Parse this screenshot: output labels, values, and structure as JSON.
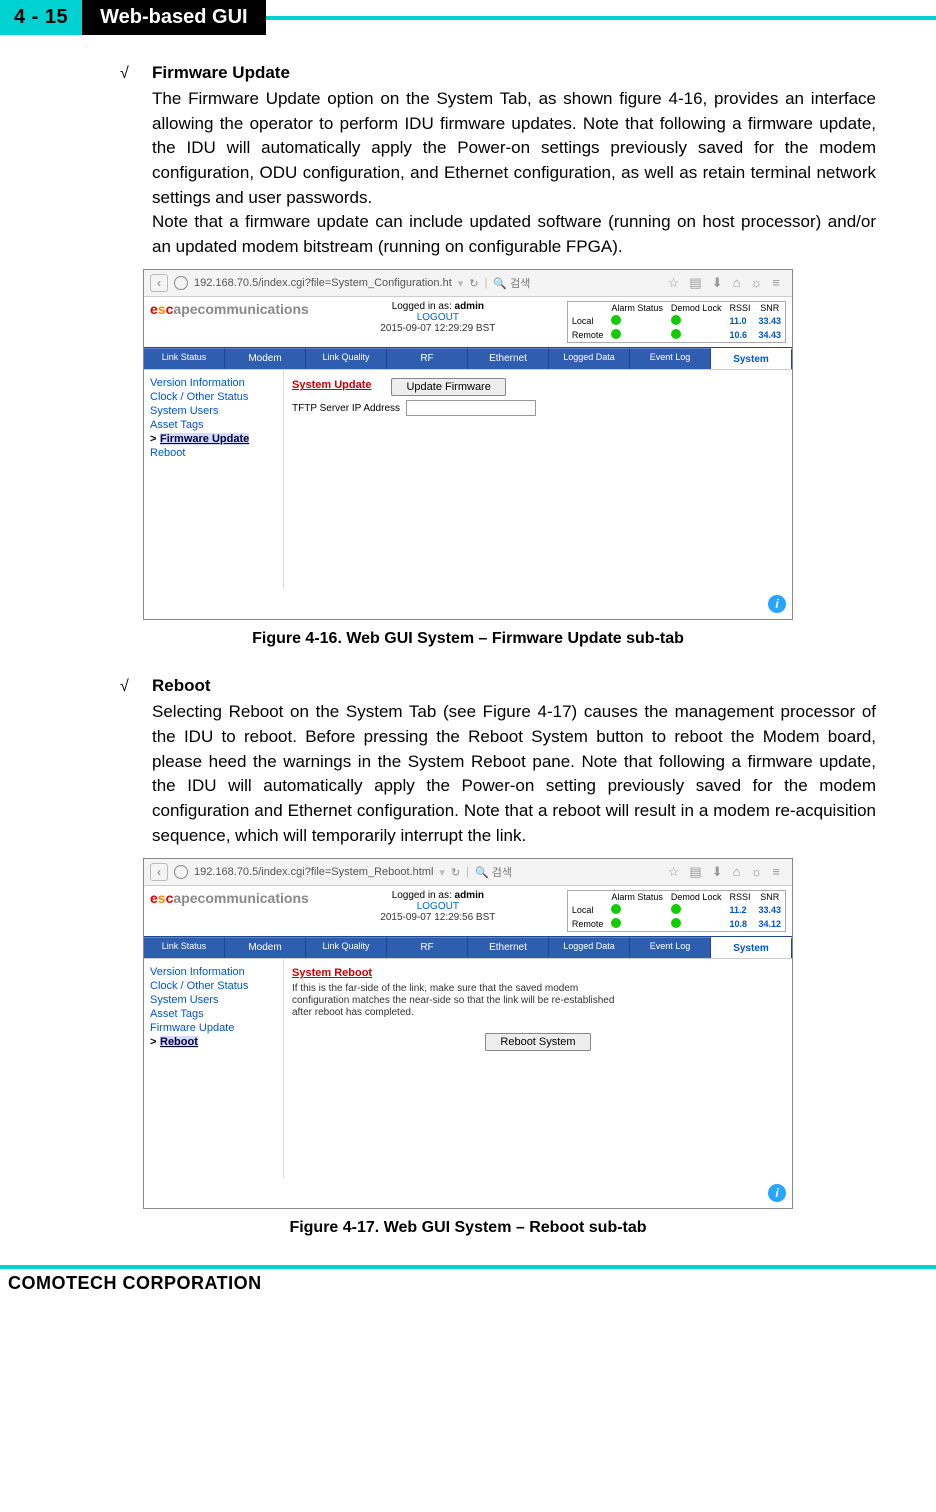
{
  "header": {
    "page_ref": "4 - 15",
    "title": "Web-based GUI"
  },
  "footer": {
    "company": "COMOTECH CORPORATION"
  },
  "firmware": {
    "heading": "Firmware Update",
    "text1": "The Firmware Update option on the System Tab, as shown figure 4-16, provides an interface allowing the operator to perform IDU firmware updates. Note that following a firmware update, the IDU will automatically apply the Power-on settings previously saved for the modem configuration, ODU configuration, and Ethernet configuration, as well as retain terminal network settings and user passwords.",
    "text2": "Note that a firmware update can include updated software (running on host processor) and/or an updated modem bitstream (running on configurable FPGA).",
    "caption": "Figure 4-16. Web GUI System – Firmware Update sub-tab"
  },
  "reboot": {
    "heading": "Reboot",
    "text": "Selecting Reboot on the System Tab (see Figure 4-17) causes the management processor of the IDU to reboot. Before pressing the Reboot System button to reboot the Modem board, please heed the warnings in the System Reboot pane. Note that following a firmware update, the IDU will automatically apply the Power-on setting previously saved for the modem configuration and Ethernet configuration. Note that a reboot will result in a modem re-acquisition sequence, which will temporarily interrupt the link.",
    "caption": "Figure 4-17. Web GUI System – Reboot sub-tab"
  },
  "shot_common": {
    "back": "‹",
    "url1": "192.168.70.5/index.cgi?file=System_Configuration.ht",
    "url2": "192.168.70.5/index.cgi?file=System_Reboot.html",
    "refresh": "↻",
    "search_icon": "🔍",
    "search_text": "검색",
    "star": "☆",
    "book": "▤",
    "down": "⬇",
    "home": "⌂",
    "sun": "☼",
    "menu": "≡",
    "logged_in_label": "Logged in as: ",
    "logged_in_user": "admin",
    "logout": "LOGOUT",
    "ts1": "2015-09-07 12:29:29 BST",
    "ts2": "2015-09-07 12:29:56 BST",
    "stat_headers": [
      "",
      "Alarm Status",
      "Demod Lock",
      "RSSI",
      "SNR"
    ],
    "local": "Local",
    "remote": "Remote",
    "rssi_l1": "11.0",
    "snr_l1": "33.43",
    "rssi_r1": "10.6",
    "snr_r1": "34.43",
    "rssi_l2": "11.2",
    "snr_l2": "33.43",
    "rssi_r2": "10.8",
    "snr_r2": "34.12",
    "tabs": [
      "Link Status",
      "Modem",
      "Link Quality",
      "RF",
      "Ethernet",
      "Logged Data",
      "Event Log",
      "System"
    ],
    "sidebar": [
      "Version Information",
      "Clock / Other Status",
      "System Users",
      "Asset Tags",
      "Firmware Update",
      "Reboot"
    ]
  },
  "shot1": {
    "panel_title": "System Update",
    "button": "Update Firmware",
    "field_label": "TFTP Server IP Address"
  },
  "shot2": {
    "panel_title": "System Reboot",
    "warning": "If this is the far-side of the link, make sure that the saved modem configuration matches the near-side so that the link will be re-established after reboot has completed.",
    "button": "Reboot System"
  }
}
